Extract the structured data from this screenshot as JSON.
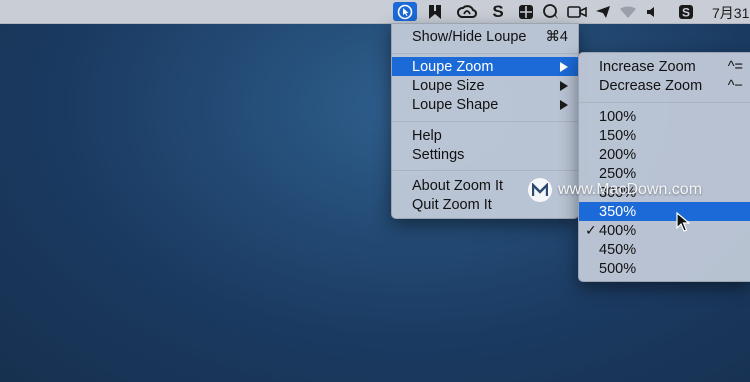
{
  "menubar": {
    "clock": "7月31",
    "icons": [
      "zoomit-icon",
      "bookmark-icon",
      "creative-cloud-icon",
      "s-app-icon",
      "grid-icon",
      "chat-icon",
      "camera-icon",
      "send-icon",
      "wifi-icon",
      "volume-icon",
      "s-box-icon"
    ]
  },
  "main_menu": {
    "items": [
      {
        "label": "Show/Hide Loupe",
        "shortcut": "⌘4"
      },
      {
        "label": "Loupe Zoom"
      },
      {
        "label": "Loupe Size"
      },
      {
        "label": "Loupe Shape"
      },
      {
        "label": "Help"
      },
      {
        "label": "Settings"
      },
      {
        "label": "About Zoom It"
      },
      {
        "label": "Quit Zoom It"
      }
    ]
  },
  "submenu": {
    "actions": [
      {
        "label": "Increase Zoom",
        "shortcut": "^="
      },
      {
        "label": "Decrease Zoom",
        "shortcut": "^−"
      }
    ],
    "levels": [
      "100%",
      "150%",
      "200%",
      "250%",
      "300%",
      "350%",
      "400%",
      "450%",
      "500%"
    ],
    "highlighted": "350%",
    "checked": "400%",
    "check_mark": "✓"
  },
  "watermark": {
    "text": "www.MacDown.com",
    "logo": "M"
  },
  "colors": {
    "highlight": "#1b6ad8",
    "desktop": "#1b3a61"
  }
}
